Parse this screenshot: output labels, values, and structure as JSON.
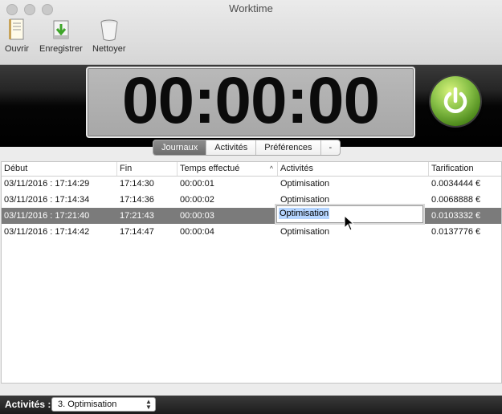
{
  "window": {
    "title": "Worktime"
  },
  "toolbar": {
    "open_label": "Ouvrir",
    "save_label": "Enregistrer",
    "clean_label": "Nettoyer"
  },
  "timer": {
    "display": "00:00:00"
  },
  "tabs": [
    {
      "label": "Journaux",
      "active": true
    },
    {
      "label": "Activités",
      "active": false
    },
    {
      "label": "Préférences",
      "active": false
    },
    {
      "label": "-",
      "active": false
    }
  ],
  "table": {
    "columns": [
      "Début",
      "Fin",
      "Temps effectué",
      "Activités",
      "Tarification"
    ],
    "rows": [
      {
        "start": "03/11/2016 : 17:14:29",
        "end": "17:14:30",
        "duration": "00:00:01",
        "activity": "Optimisation",
        "rate": "0.0034444 €"
      },
      {
        "start": "03/11/2016 : 17:14:34",
        "end": "17:14:36",
        "duration": "00:00:02",
        "activity": "Optimisation",
        "rate": "0.0068888 €"
      },
      {
        "start": "03/11/2016 : 17:21:40",
        "end": "17:21:43",
        "duration": "00:00:03",
        "activity": "Optimisation",
        "rate": "0.0103332 €"
      },
      {
        "start": "03/11/2016 : 17:14:42",
        "end": "17:14:47",
        "duration": "00:00:04",
        "activity": "Optimisation",
        "rate": "0.0137776 €"
      }
    ],
    "editing_value": "Optimisation"
  },
  "footer": {
    "activities_label": "Activités :",
    "selected_activity": "3. Optimisation"
  },
  "colors": {
    "accent_selected_row": "#7b7b7b",
    "power_button": "#8bc34a",
    "text_selection": "#b5d5ff"
  }
}
